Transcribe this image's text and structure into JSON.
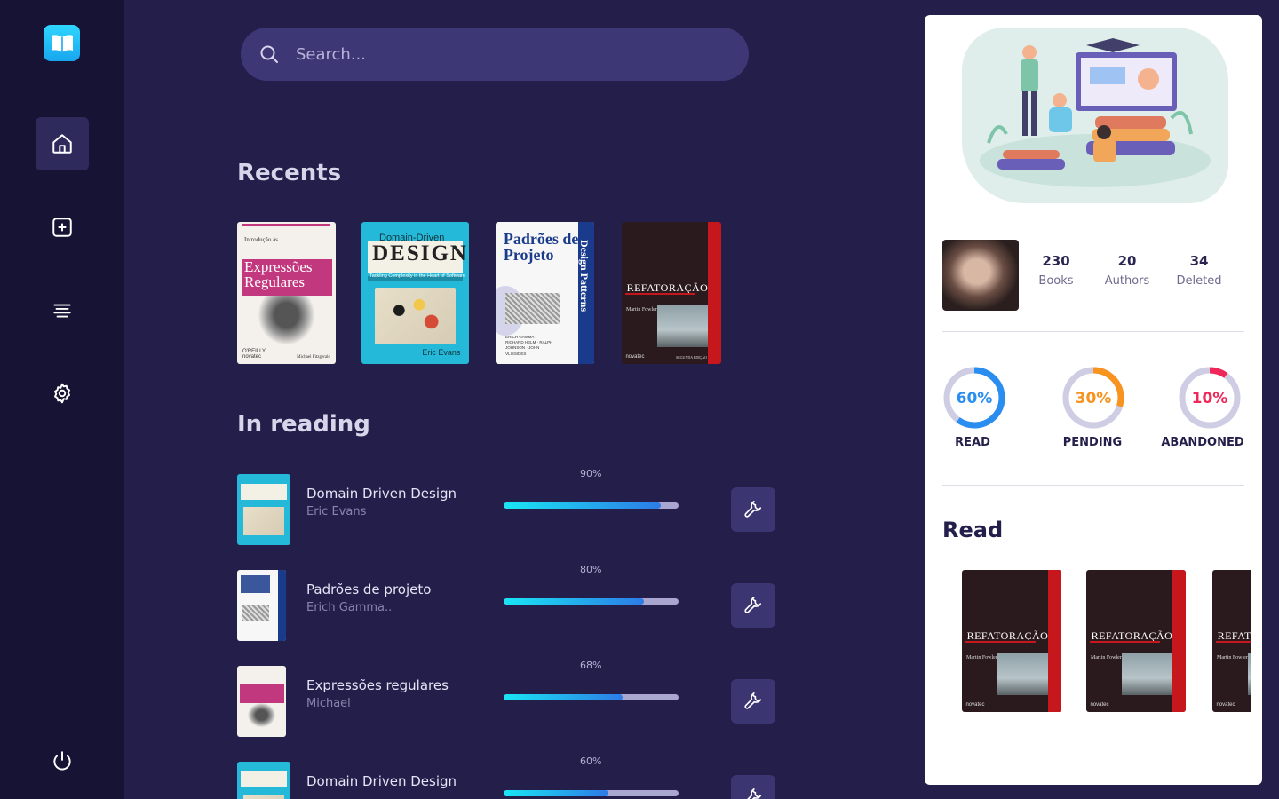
{
  "search": {
    "placeholder": "Search..."
  },
  "sections": {
    "recents": "Recents",
    "in_reading": "In reading",
    "read": "Read"
  },
  "covers": {
    "expressoes": {
      "title_a": "Expressões",
      "title_b": "Regulares",
      "top": "Introdução às",
      "pub": "O'REILLY novatec",
      "author": "Michael Fitzgerald"
    },
    "ddd": {
      "top": "Domain-Driven",
      "title": "DESIGN",
      "sub": "Tackling Complexity in the Heart of Software",
      "author": "Eric Evans",
      "fwd": "Foreword by Martin Fowler"
    },
    "padroes": {
      "title_a": "Padrões de",
      "title_b": "Projeto",
      "spine": "Design Patterns",
      "names": "ERICH GAMMA · RICHARD HELM · RALPH JOHNSON · JOHN VLISSIDES"
    },
    "refatoracao": {
      "title": "REFATORAÇÃO",
      "author": "Martin Fowler",
      "pub": "novatec",
      "edition": "SEGUNDA EDIÇÃO"
    }
  },
  "reading": [
    {
      "title": "Domain Driven Design",
      "author": "Eric Evans",
      "progress_label": "90%",
      "progress": 90,
      "cover": "ddd"
    },
    {
      "title": "Padrões de projeto",
      "author": "Erich Gamma..",
      "progress_label": "80%",
      "progress": 80,
      "cover": "padroes"
    },
    {
      "title": "Expressões regulares",
      "author": "Michael",
      "progress_label": "68%",
      "progress": 68,
      "cover": "expressoes"
    },
    {
      "title": "Domain Driven Design",
      "author": "",
      "progress_label": "60%",
      "progress": 60,
      "cover": "ddd"
    }
  ],
  "stats": [
    {
      "value": "230",
      "label": "Books"
    },
    {
      "value": "20",
      "label": "Authors"
    },
    {
      "value": "34",
      "label": "Deleted"
    }
  ],
  "rings": [
    {
      "label": "READ",
      "value_label": "60%",
      "fraction": 0.6,
      "color": "#2a8df0"
    },
    {
      "label": "PENDING",
      "value_label": "30%",
      "fraction": 0.3,
      "color": "#f7931e"
    },
    {
      "label": "ABANDONED",
      "value_label": "10%",
      "fraction": 0.1,
      "color": "#f0285a"
    }
  ],
  "colors": {
    "accent": "#19e6f4",
    "sidebar": "#161334",
    "background": "#231e4a"
  },
  "icons": [
    "book-open-icon",
    "home-icon",
    "plus-square-icon",
    "align-center-icon",
    "gear-icon",
    "power-icon",
    "search-icon",
    "wrench-icon"
  ]
}
